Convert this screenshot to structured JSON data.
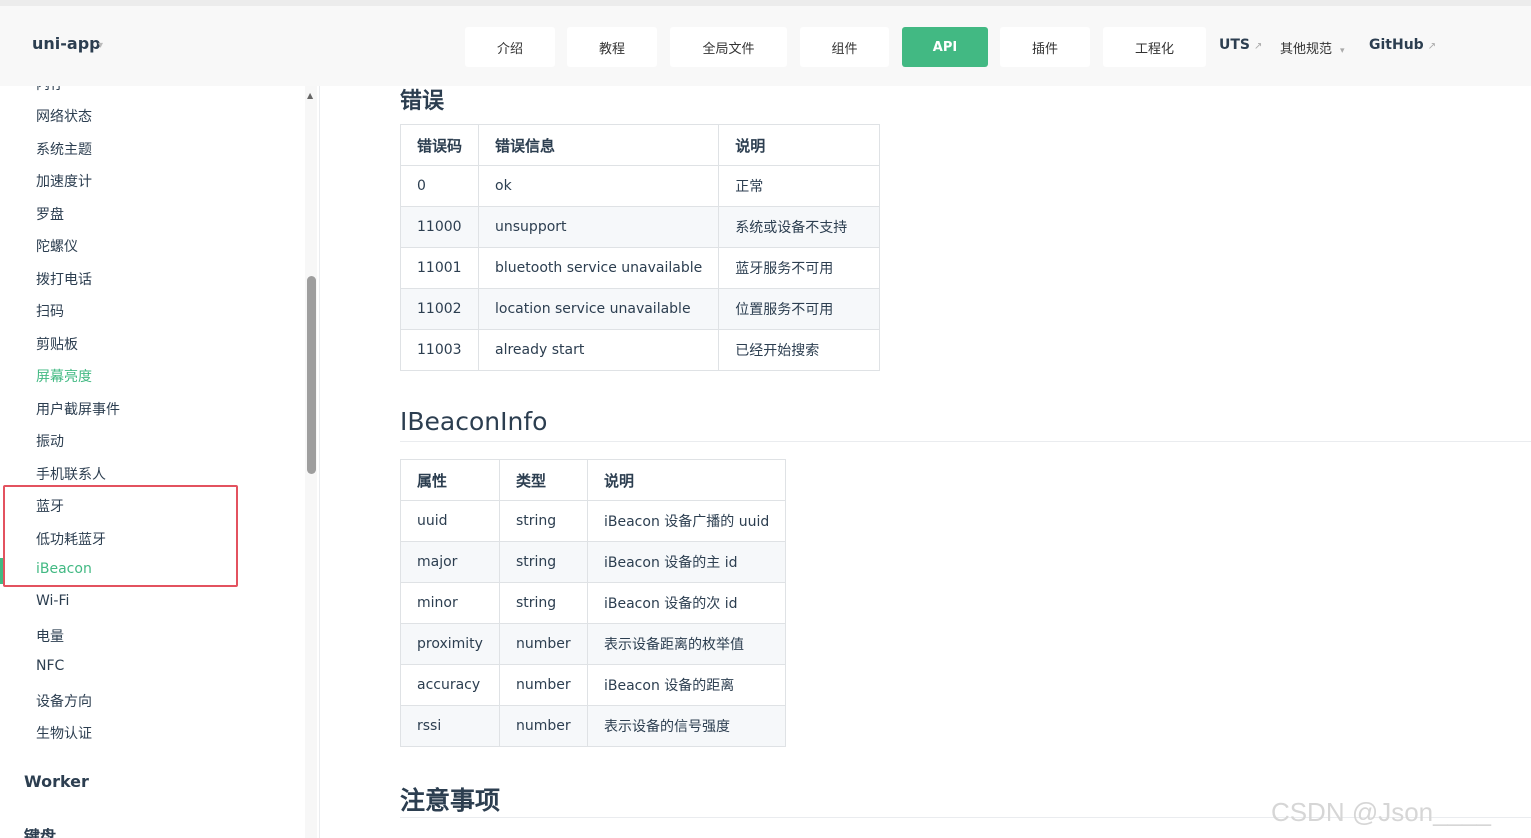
{
  "header": {
    "brand": "uni-app",
    "brand_caret": "▾",
    "nav": [
      {
        "label": "介绍"
      },
      {
        "label": "教程"
      },
      {
        "label": "全局文件"
      },
      {
        "label": "组件"
      },
      {
        "label": "API"
      },
      {
        "label": "插件"
      },
      {
        "label": "工程化"
      }
    ],
    "uts": "UTS",
    "other": "其他规范",
    "github": "GitHub",
    "external_icon": "↗",
    "caret": "▾"
  },
  "sidebar": {
    "partial_top": "内存",
    "items": [
      {
        "label": "网络状态"
      },
      {
        "label": "系统主题"
      },
      {
        "label": "加速度计"
      },
      {
        "label": "罗盘"
      },
      {
        "label": "陀螺仪"
      },
      {
        "label": "拨打电话"
      },
      {
        "label": "扫码"
      },
      {
        "label": "剪贴板"
      },
      {
        "label": "屏幕亮度"
      },
      {
        "label": "用户截屏事件"
      },
      {
        "label": "振动"
      },
      {
        "label": "手机联系人"
      },
      {
        "label": "蓝牙"
      },
      {
        "label": "低功耗蓝牙"
      },
      {
        "label": "iBeacon"
      },
      {
        "label": "Wi-Fi"
      },
      {
        "label": "电量"
      },
      {
        "label": "NFC"
      },
      {
        "label": "设备方向"
      },
      {
        "label": "生物认证"
      }
    ],
    "worker": "Worker",
    "keyboard": "键盘"
  },
  "errors": {
    "title": "错误",
    "headers": [
      "错误码",
      "错误信息",
      "说明"
    ],
    "rows": [
      [
        "0",
        "ok",
        "正常"
      ],
      [
        "11000",
        "unsupport",
        "系统或设备不支持"
      ],
      [
        "11001",
        "bluetooth service unavailable",
        "蓝牙服务不可用"
      ],
      [
        "11002",
        "location service unavailable",
        "位置服务不可用"
      ],
      [
        "11003",
        "already start",
        "已经开始搜索"
      ]
    ]
  },
  "ibeacon": {
    "title": "IBeaconInfo",
    "headers": [
      "属性",
      "类型",
      "说明"
    ],
    "rows": [
      [
        "uuid",
        "string",
        "iBeacon 设备广播的 uuid"
      ],
      [
        "major",
        "string",
        "iBeacon 设备的主 id"
      ],
      [
        "minor",
        "string",
        "iBeacon 设备的次 id"
      ],
      [
        "proximity",
        "number",
        "表示设备距离的枚举值"
      ],
      [
        "accuracy",
        "number",
        "iBeacon 设备的距离"
      ],
      [
        "rssi",
        "number",
        "表示设备的信号强度"
      ]
    ]
  },
  "notes": {
    "title": "注意事项"
  },
  "watermark": "CSDN @Json____",
  "colors": {
    "accent": "#42b983",
    "highlight": "#e3525f"
  }
}
